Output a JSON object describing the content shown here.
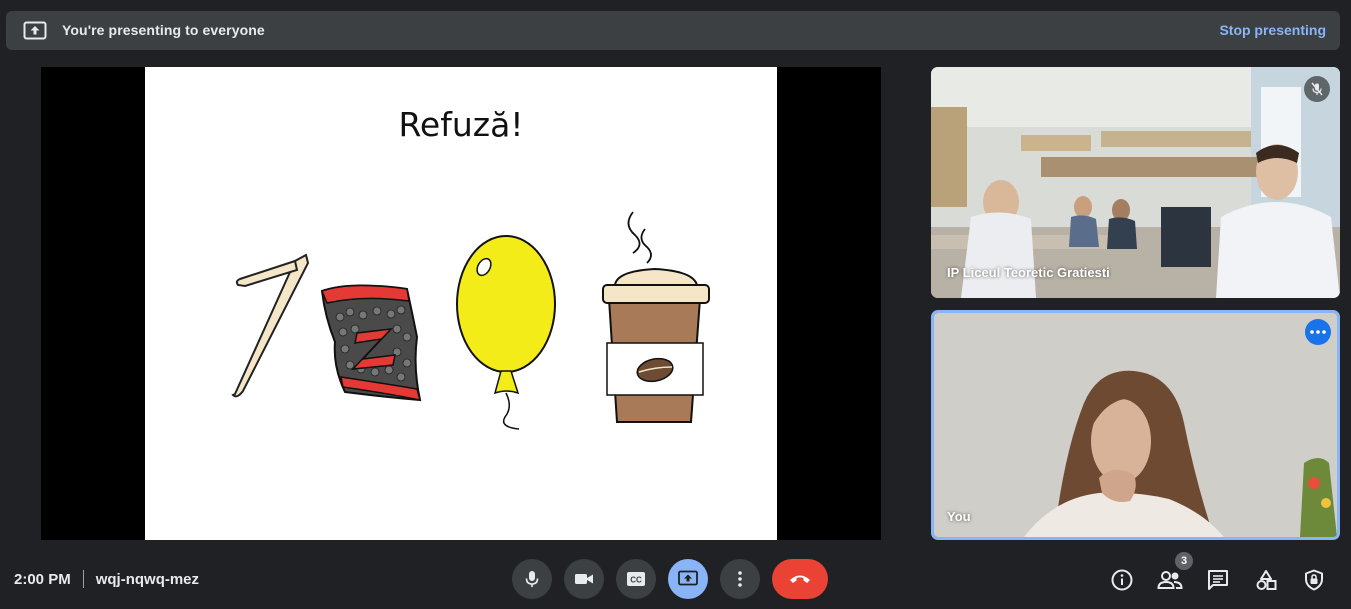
{
  "banner": {
    "text": "You're presenting to everyone",
    "stop_label": "Stop presenting"
  },
  "slide": {
    "title": "Refuză!",
    "items": [
      "straw-icon",
      "candy-wrapper-icon",
      "balloon-icon",
      "coffee-cup-icon"
    ]
  },
  "participants": [
    {
      "name": "IP Liceul Teoretic Gratiesti",
      "muted": true
    },
    {
      "name": "You",
      "muted": false
    }
  ],
  "meeting": {
    "time": "2:00 PM",
    "code": "wqj-nqwq-mez",
    "participant_count": "3"
  },
  "colors": {
    "accent": "#8ab4f8",
    "end_call": "#ea4335",
    "toolbar": "#3c4043",
    "background": "#202124"
  }
}
